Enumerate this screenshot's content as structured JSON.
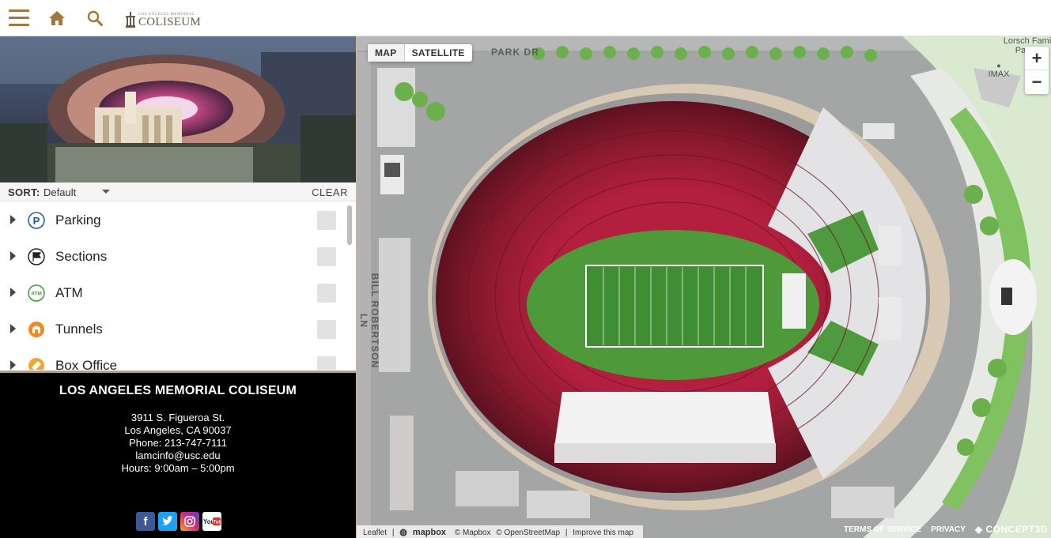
{
  "header": {
    "menu_icon": "hamburger-icon",
    "home_icon": "home-icon",
    "search_icon": "search-icon",
    "logo_small": "LOS ANGELES MEMORIAL",
    "logo_text": "COLISEUM"
  },
  "sort": {
    "label": "SORT:",
    "value": "Default",
    "clear_label": "CLEAR"
  },
  "categories": [
    {
      "label": "Parking",
      "icon": "parking-icon"
    },
    {
      "label": "Sections",
      "icon": "flag-icon"
    },
    {
      "label": "ATM",
      "icon": "atm-icon"
    },
    {
      "label": "Tunnels",
      "icon": "tunnel-icon"
    },
    {
      "label": "Box Office",
      "icon": "ticket-icon"
    }
  ],
  "footer": {
    "title": "LOS ANGELES MEMORIAL COLISEUM",
    "address1": "3911 S. Figueroa St.",
    "address2": "Los Angeles, CA 90037",
    "phone": "Phone: 213-747-7111",
    "email": "lamcinfo@usc.edu",
    "hours": "Hours: 9:00am – 5:00pm",
    "social": [
      "facebook-icon",
      "twitter-icon",
      "instagram-icon",
      "youtube-icon"
    ],
    "youtube_label": "You Tube"
  },
  "map": {
    "toggle": {
      "map_label": "MAP",
      "satellite_label": "SATELLITE",
      "active": "MAP"
    },
    "zoom_in": "+",
    "zoom_out": "−",
    "street_top": "PARK DR",
    "street_left": "BILL ROBERTSON LN",
    "place_pavilion": "Lorsch Family Pavilion",
    "place_imax": "IMAX",
    "attribution": {
      "leaflet": "Leaflet",
      "sep1": "|",
      "mapbox_logo": "mapbox",
      "mapbox": "© Mapbox",
      "osm": "© OpenStreetMap",
      "sep2": "|",
      "improve": "Improve this map"
    },
    "terms": "TERMS OF SERVICE",
    "privacy": "PRIVACY",
    "brand": "CONCEPT3D"
  },
  "colors": {
    "accent": "#a0783a",
    "seat_red": "#8b1a2e",
    "field_green": "#4e9a3a",
    "grass": "#7cbf5e",
    "road": "#8e8f8f"
  }
}
